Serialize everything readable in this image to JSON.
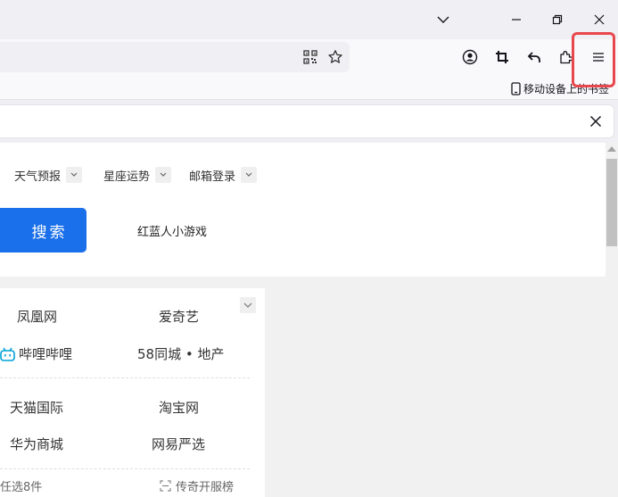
{
  "browser": {
    "bookmarks_bar": {
      "mobile_bookmarks_label": "移动设备上的书签"
    }
  },
  "page": {
    "quick_links": [
      {
        "label": "天气预报"
      },
      {
        "label": "星座运势"
      },
      {
        "label": "邮箱登录"
      }
    ],
    "search_button_label": "搜索",
    "hot_link": "红蓝人小游戏",
    "sites": [
      {
        "label": "凤凰网"
      },
      {
        "label": "爱奇艺"
      },
      {
        "label": "哔哩哔哩"
      },
      {
        "label": "58同城 • 地产"
      },
      {
        "label": "天猫国际"
      },
      {
        "label": "淘宝网"
      },
      {
        "label": "华为商城"
      },
      {
        "label": "网易严选"
      }
    ],
    "footer_left": "任选8件",
    "footer_right": "传奇开服榜"
  }
}
